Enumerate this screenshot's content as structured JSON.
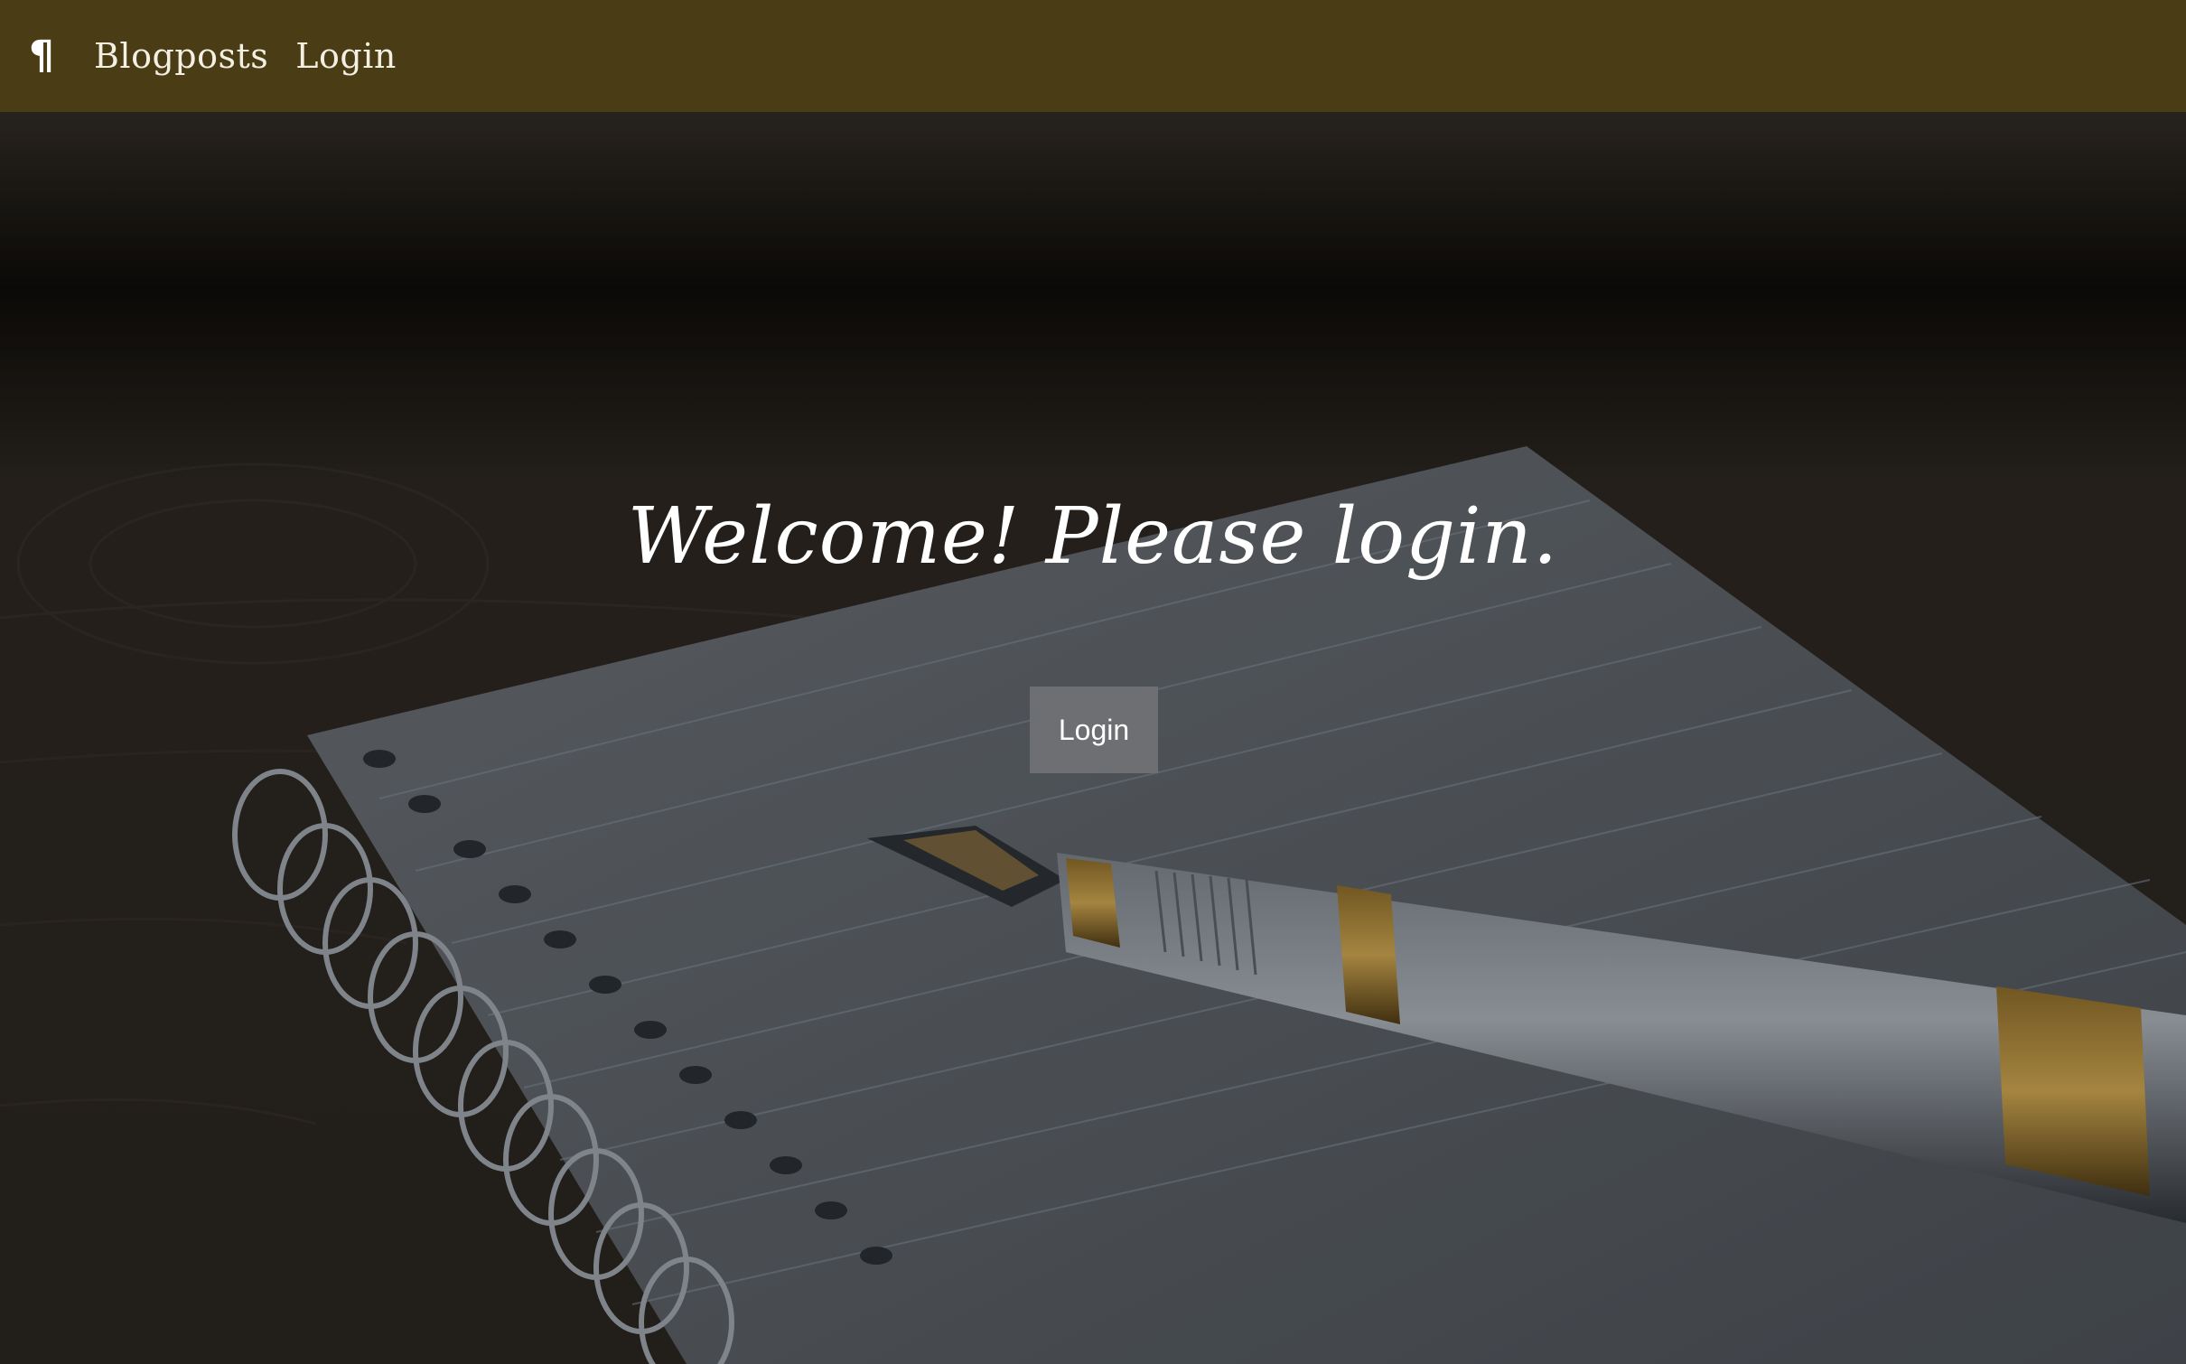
{
  "navbar": {
    "brand_icon": "pilcrow-icon",
    "links": [
      {
        "label": "Blogposts"
      },
      {
        "label": "Login"
      }
    ],
    "colors": {
      "background": "#4a3c14",
      "text": "#f3efe2"
    }
  },
  "hero": {
    "title": "Welcome! Please login.",
    "button_label": "Login",
    "background_image": "notebook-and-fountain-pen"
  }
}
